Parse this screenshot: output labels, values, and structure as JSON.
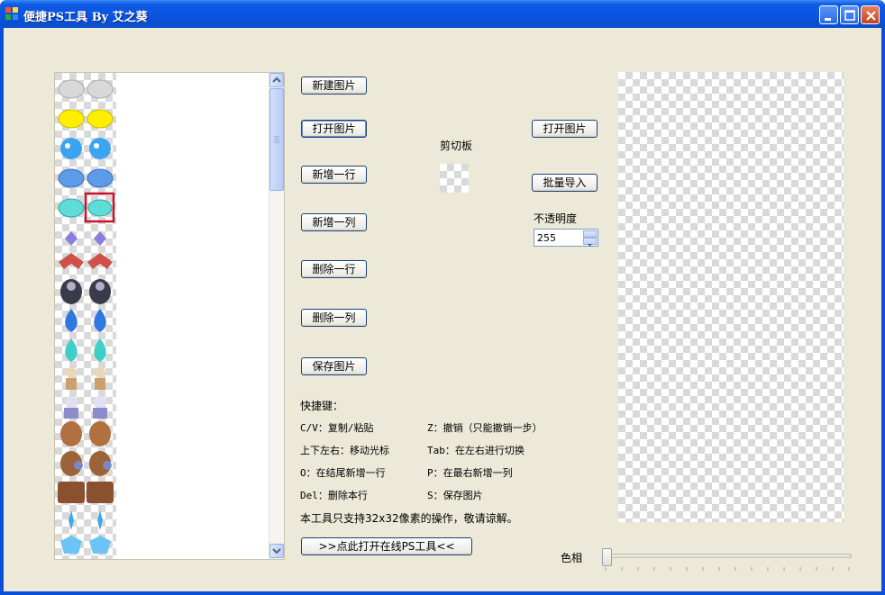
{
  "window": {
    "title": "便捷PS工具 By 艾之葵"
  },
  "buttons": {
    "new_image": "新建图片",
    "open_image_left": "打开图片",
    "add_row": "新增一行",
    "add_column": "新增一列",
    "delete_row": "删除一行",
    "delete_column": "删除一列",
    "save_image": "保存图片",
    "open_image_right": "打开图片",
    "batch_import": "批量导入",
    "open_online": ">>点此打开在线PS工具<<"
  },
  "clipboard": {
    "label": "剪切板"
  },
  "opacity": {
    "label": "不透明度",
    "value": "255"
  },
  "hue": {
    "label": "色相",
    "value_fraction": 0
  },
  "shortcuts": {
    "header": "快捷键：",
    "items": [
      "C/V：复制/粘贴",
      "Z：撤销（只能撤销一步）",
      "上下左右：移动光标",
      "Tab：在左右进行切换",
      "O：在结尾新增一行",
      "P：在最右新增一列",
      "Del：删除本行",
      "S：保存图片"
    ],
    "note": "本工具只支持32x32像素的操作，敬请谅解。"
  },
  "sprite_rows": [
    "gray-slime",
    "yellow-slime",
    "blue-splash",
    "blue-slime",
    "teal-slime",
    "crystal",
    "red-bat",
    "dark-cloak",
    "blue-flame",
    "teal-flame",
    "skeleton",
    "ghost-skeleton",
    "brown-golem",
    "golem-shield",
    "rock-block",
    "ice-sparkle",
    "ice-crystal"
  ],
  "colors": {
    "titlebar": "#0a52df",
    "client_bg": "#ece9d8",
    "close_button": "#c8401e",
    "selection": "#c8102e"
  }
}
